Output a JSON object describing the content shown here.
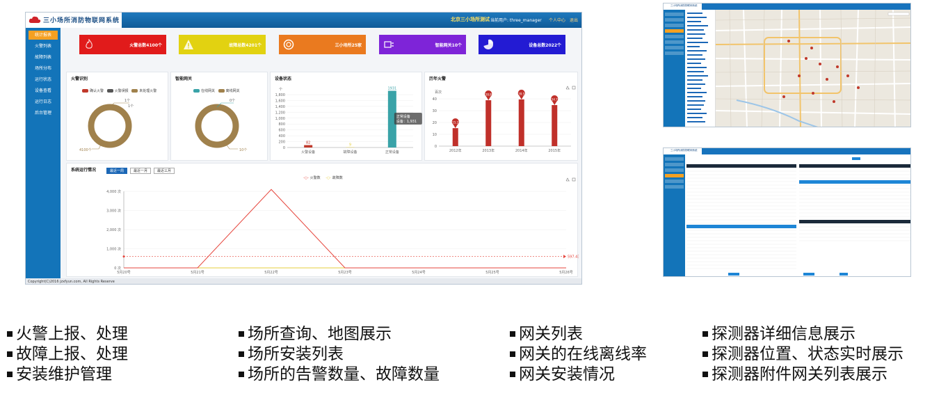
{
  "app": {
    "title": "三小场所消防物联网系统",
    "place": "北京三小场所测试",
    "user": "当前用户: three_manager",
    "links": [
      "个人中心",
      "退出"
    ],
    "footer": "Copyright(C)2016 jzxfyun.com, All Rights Reserve"
  },
  "sidebar": {
    "items": [
      "统计报表",
      "火警列表",
      "故障列表",
      "场所分布",
      "运行状态",
      "设备查看",
      "运行日志",
      "后台管理"
    ],
    "active_index": 0
  },
  "stats": [
    {
      "label": "火警总数4100个",
      "color": "#e11b1b",
      "icon": "fire-icon"
    },
    {
      "label": "故障总数4201个",
      "color": "#e2d211",
      "icon": "warning-icon"
    },
    {
      "label": "三小场所25家",
      "color": "#ea7a1f",
      "icon": "building-icon"
    },
    {
      "label": "智能网关10个",
      "color": "#7e24d8",
      "icon": "gateway-icon"
    },
    {
      "label": "设备总数2022个",
      "color": "#231bd3",
      "icon": "pie-icon"
    }
  ],
  "panels": {
    "fire": {
      "title": "火警识别",
      "legend": [
        "确认火警",
        "火警误报",
        "未处理火警"
      ],
      "colors": [
        "#c0392b",
        "#555555",
        "#a0814c"
      ],
      "labels": [
        "1个",
        "1个",
        "4100个"
      ]
    },
    "gateway": {
      "title": "智能网关",
      "legend": [
        "在线网关",
        "离线网关"
      ],
      "colors": [
        "#3aa3a8",
        "#a0814c"
      ],
      "labels": [
        "0个",
        "10个"
      ]
    },
    "device": {
      "title": "设备状态"
    },
    "history": {
      "title": "历年火警"
    },
    "system": {
      "title": "系统运行情况",
      "ranges": [
        "最近一周",
        "最近一月",
        "最近三月"
      ],
      "range_active": 0,
      "legend": [
        "火警数",
        "故障数"
      ]
    }
  },
  "chart_data": [
    {
      "type": "pie",
      "title": "火警识别",
      "categories": [
        "确认火警",
        "火警误报",
        "未处理火警"
      ],
      "values": [
        1,
        1,
        4100
      ],
      "data_labels": [
        "1个",
        "1个",
        "4100个"
      ]
    },
    {
      "type": "pie",
      "title": "智能网关",
      "categories": [
        "在线网关",
        "离线网关"
      ],
      "values": [
        0,
        10
      ],
      "data_labels": [
        "0个",
        "10个"
      ]
    },
    {
      "type": "bar",
      "title": "设备状态",
      "ylabel": "个",
      "categories": [
        "火警设备",
        "故障设备",
        "正常设备"
      ],
      "values": [
        82,
        9,
        1931
      ],
      "ylim": [
        0,
        1800
      ],
      "yticks": [
        "0",
        "200",
        "400",
        "600",
        "800",
        "1,000",
        "1,200",
        "1,400",
        "1,600",
        "1,800"
      ],
      "tooltip": {
        "title": "正常设备",
        "text": "设备：1,931"
      }
    },
    {
      "type": "bar",
      "title": "历年火警",
      "ylabel": "百次",
      "categories": [
        "2012年",
        "2013年",
        "2014年",
        "2015年"
      ],
      "values": [
        15.2,
        38.8,
        39.5,
        34.7
      ],
      "ylim": [
        0,
        40
      ],
      "yticks": [
        "0",
        "10",
        "20",
        "30",
        "40"
      ]
    },
    {
      "type": "line",
      "title": "系统运行情况",
      "x": [
        "5月20号",
        "5月21号",
        "5月22号",
        "5月23号",
        "5月24号",
        "5月25号",
        "5月26号"
      ],
      "series": [
        {
          "name": "火警数",
          "values": [
            0,
            0,
            4100,
            0,
            0,
            0,
            0
          ]
        },
        {
          "name": "故障数",
          "values": [
            0,
            0,
            0,
            0,
            0,
            0,
            0
          ]
        }
      ],
      "yticks": [
        "0 次",
        "1,000 次",
        "2,000 次",
        "3,000 次",
        "4,000 次"
      ],
      "ylim": [
        0,
        4000
      ],
      "average": {
        "value": 597.43,
        "label": "597.43"
      }
    }
  ],
  "thumbs": {
    "map_title": "三小场所消防物联网系统",
    "list_title": "三小场所消防物联网系统"
  },
  "captions": [
    [
      "火警上报、处理",
      "故障上报、处理",
      "安装维护管理"
    ],
    [
      "场所查询、地图展示",
      "场所安装列表",
      "场所的告警数量、故障数量"
    ],
    [
      "网关列表",
      "网关的在线离线率",
      "网关安装情况"
    ],
    [
      "探测器详细信息展示",
      "探测器位置、状态实时展示",
      "探测器附件网关列表展示"
    ]
  ]
}
